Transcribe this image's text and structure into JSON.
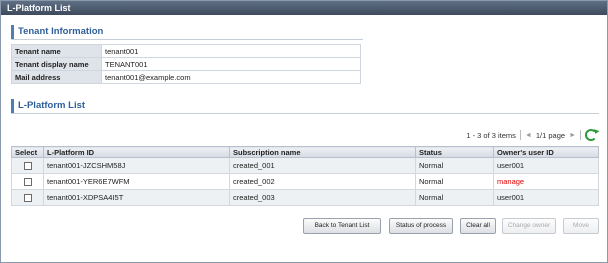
{
  "window": {
    "title": "L-Platform List"
  },
  "tenant_info": {
    "heading": "Tenant Information",
    "rows": [
      {
        "label": "Tenant name",
        "value": "tenant001"
      },
      {
        "label": "Tenant display name",
        "value": "TENANT001"
      },
      {
        "label": "Mail address",
        "value": "tenant001@example.com"
      }
    ]
  },
  "lplatform": {
    "heading": "L-Platform List",
    "pager": {
      "items": "1 - 3 of 3 items",
      "page": "1/1 page",
      "first": "◄",
      "prev": "◄",
      "next": "►",
      "last": "►"
    },
    "columns": [
      "Select",
      "L-Platform ID",
      "Subscription name",
      "Status",
      "Owner's user ID"
    ],
    "rows": [
      {
        "id": "tenant001-JZCSHM58J",
        "subscription": "created_001",
        "status": "Normal",
        "owner": "user001"
      },
      {
        "id": "tenant001-YER6E7WFM",
        "subscription": "created_002",
        "status": "Normal",
        "owner": "manage"
      },
      {
        "id": "tenant001-XDPSA4I5T",
        "subscription": "created_003",
        "status": "Normal",
        "owner": "user001"
      }
    ]
  },
  "buttons": {
    "back": "Back to Tenant List",
    "status": "Status of process",
    "clear": "Clear all",
    "change_owner": "Change owner",
    "move": "Move"
  },
  "colors": {
    "accent": "#2f5f99",
    "owner_highlight": "#e00000",
    "refresh": "#2a9a3a"
  },
  "icons": {
    "refresh": "refresh-icon"
  }
}
